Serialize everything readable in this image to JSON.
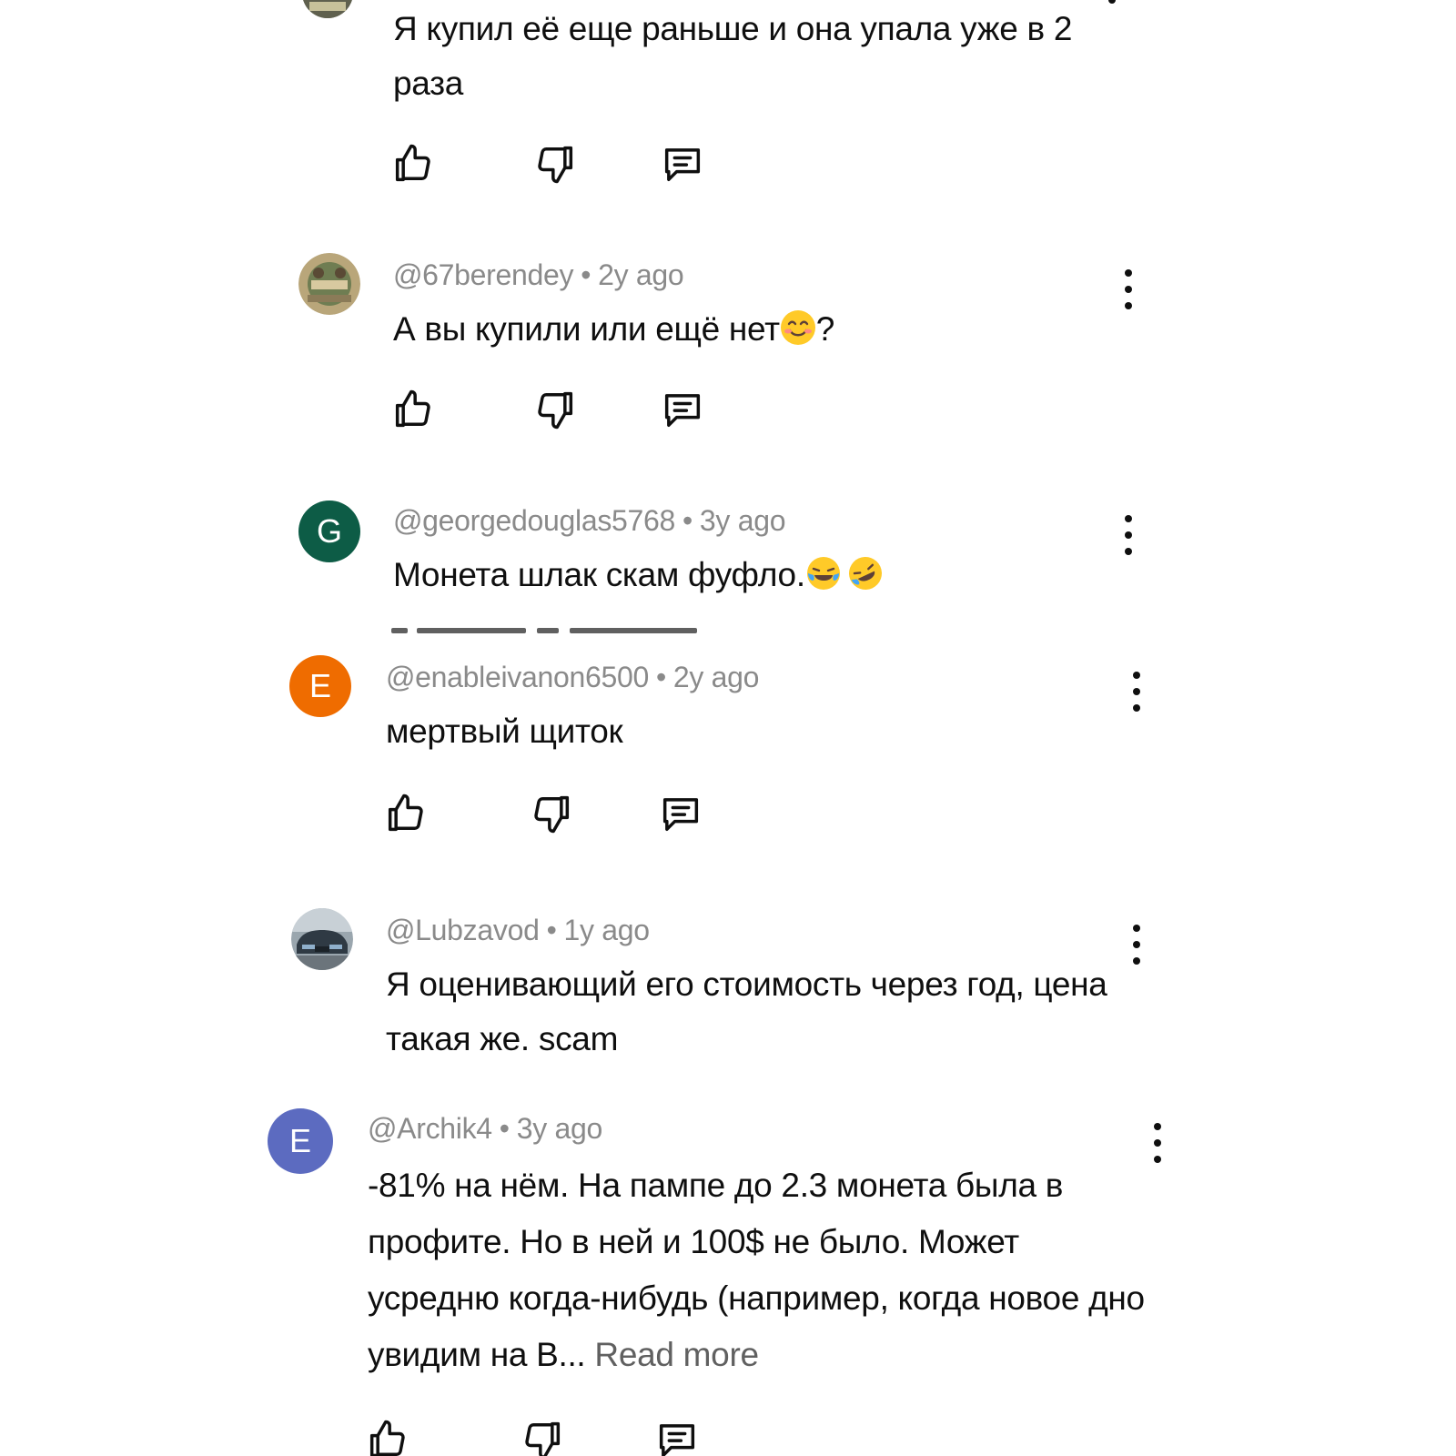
{
  "comments": [
    {
      "text": "Я купил её еще раньше и она упала уже в 2 раза",
      "actions": [
        "like-icon",
        "dislike-icon",
        "reply-icon"
      ]
    },
    {
      "handle": "@67berendey",
      "separator": "•",
      "time": "2y ago",
      "text": "А вы купили или ещё нет",
      "emoji": "smiling-face",
      "text_suffix": "?",
      "avatar": "photo-avatar-scenery",
      "actions": [
        "like-icon",
        "dislike-icon",
        "reply-icon"
      ]
    },
    {
      "handle": "@georgedouglas5768",
      "separator": "•",
      "time": "3y ago",
      "text": "Монета шлак скам фуфло.",
      "emoji": [
        "tears-of-joy",
        "rolling-on-floor-laughing"
      ],
      "avatar_letter": "G",
      "avatar_color": "#0d5c46"
    },
    {
      "handle": "@enableivanon6500",
      "separator": "•",
      "time": "2y ago",
      "text": "мертвый щиток",
      "avatar_letter": "E",
      "avatar_color": "#ef6c00",
      "actions": [
        "like-icon",
        "dislike-icon",
        "reply-icon"
      ]
    },
    {
      "handle": "@Lubzavod",
      "separator": "•",
      "time": "1y ago",
      "text": "Я оценивающий его стоимость через год, цена такая же. scam",
      "avatar": "photo-avatar-car"
    },
    {
      "handle": "@Archik4",
      "separator": "•",
      "time": "3y ago",
      "text": "-81% на нём. На пампе до 2.3 монета была в профите. Но в ней и 100$ не было. Может усредню когда-нибудь (например, когда новое дно увидим на B...",
      "read_more": "Read more",
      "avatar_letter": "E",
      "avatar_color": "#5c6bc0",
      "actions": [
        "like-icon",
        "dislike-icon",
        "reply-icon"
      ]
    }
  ]
}
